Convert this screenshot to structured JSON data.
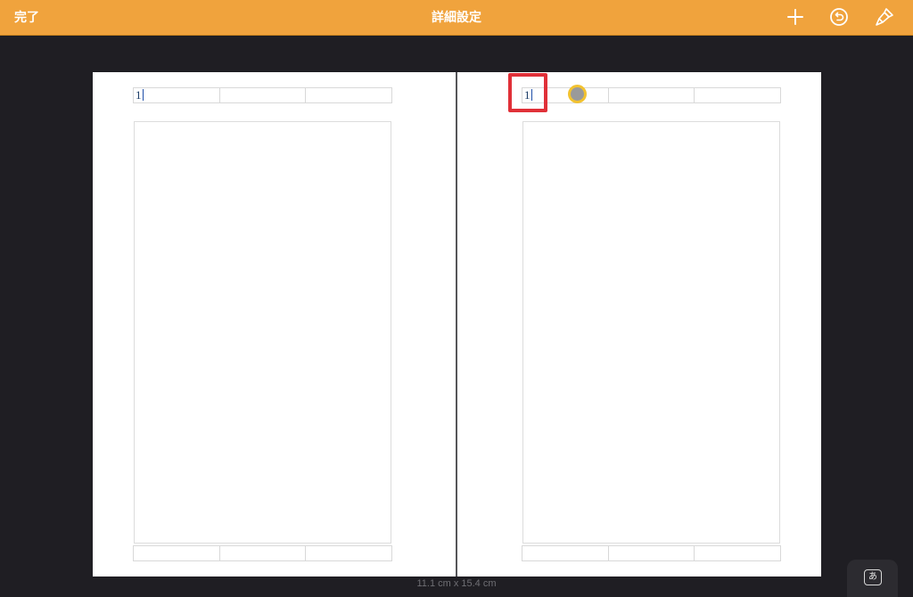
{
  "toolbar": {
    "done_label": "完了",
    "title": "詳細設定",
    "icons": [
      "plus-icon",
      "undo-icon",
      "brush-icon"
    ],
    "background_color": "#f0a33d"
  },
  "pages": {
    "left": {
      "header_first_cell": "1"
    },
    "right": {
      "header_first_cell": "1"
    }
  },
  "size_label": "11.1 cm x 15.4 cm",
  "keyboard_button": {
    "label": "あ"
  },
  "colors": {
    "highlight": "#e03038",
    "touch_indicator": "#f2c230"
  }
}
